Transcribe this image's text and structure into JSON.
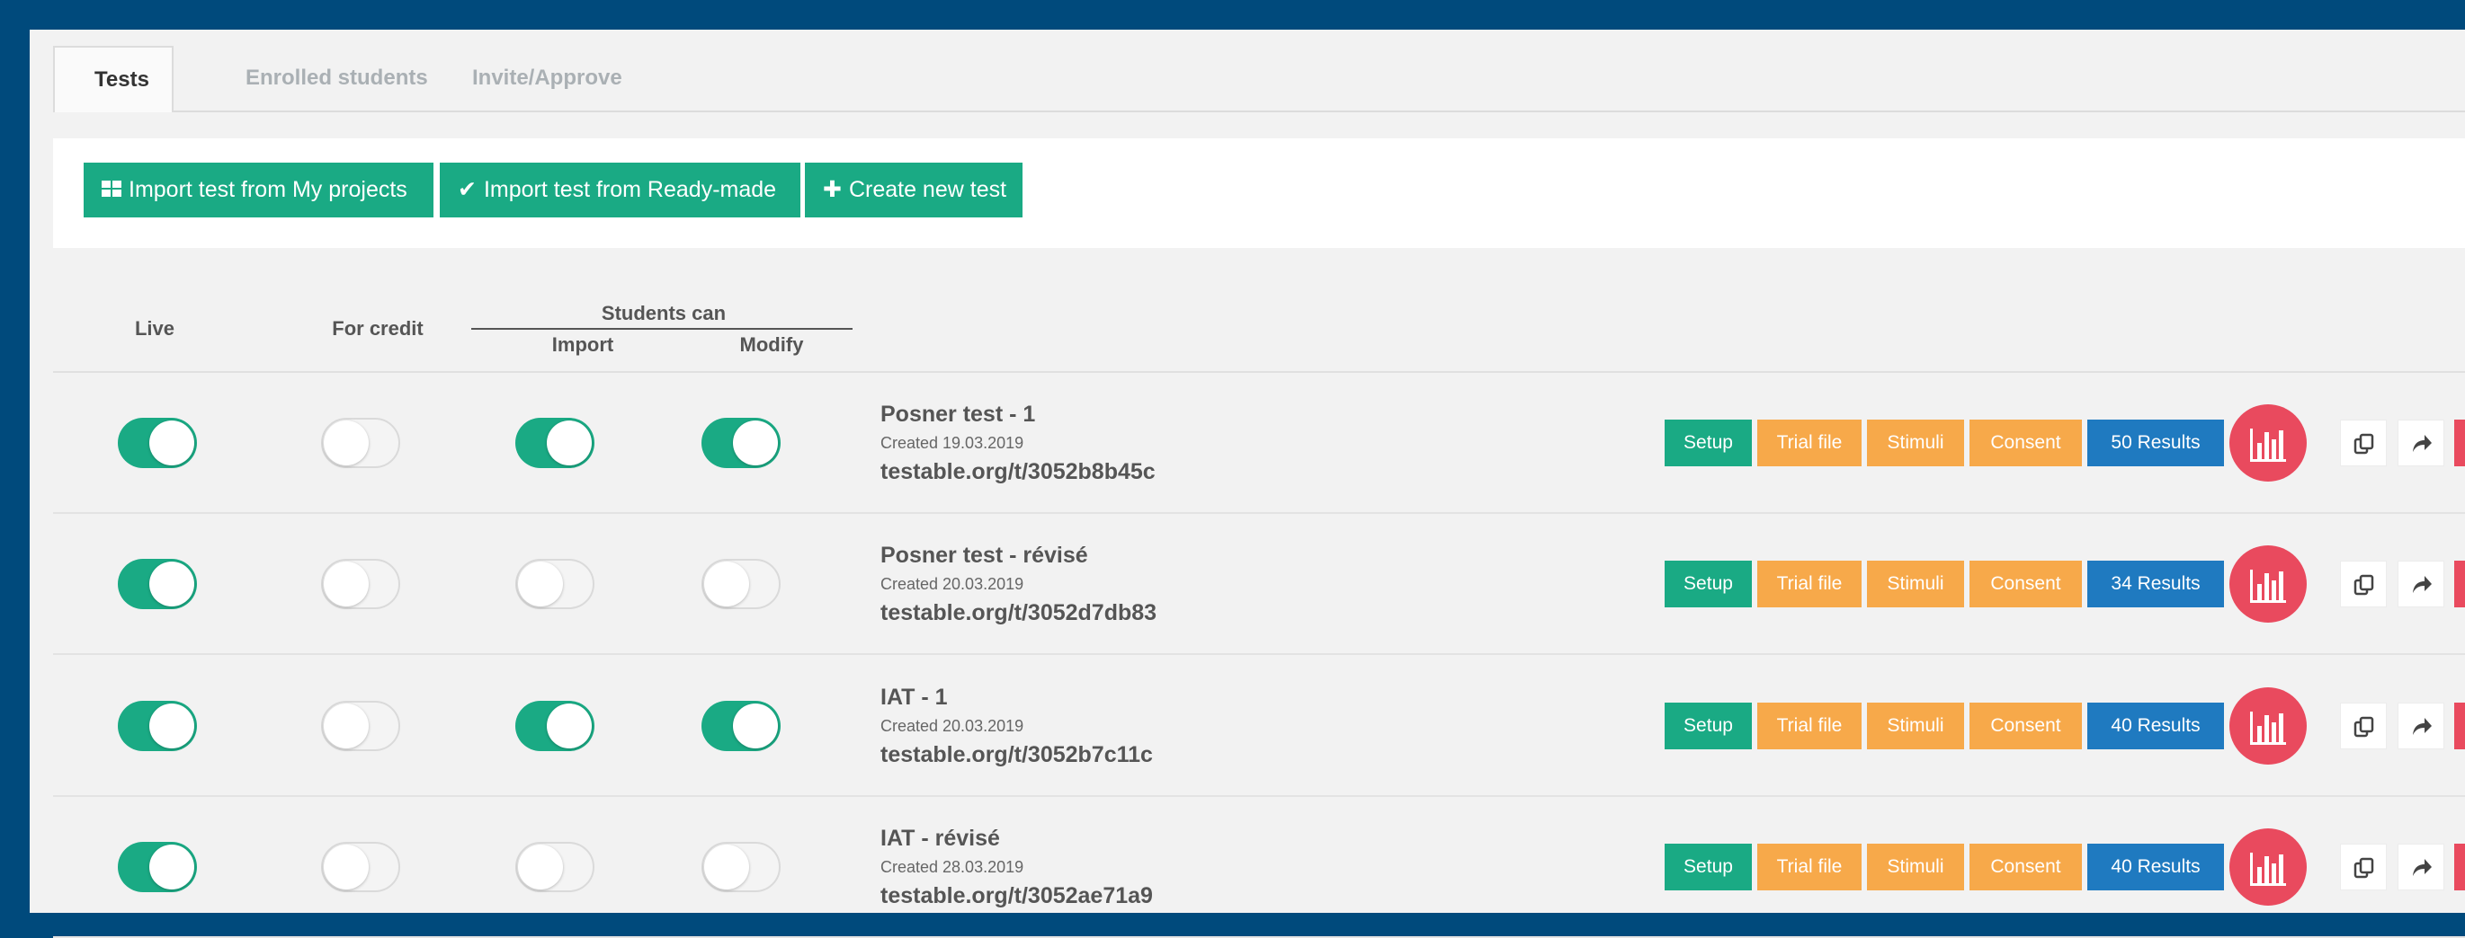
{
  "tabs": [
    {
      "label": "Tests",
      "active": true
    },
    {
      "label": "Enrolled students",
      "active": false
    },
    {
      "label": "Invite/Approve",
      "active": false
    }
  ],
  "toolbar": {
    "import_projects": "Import test from My projects",
    "import_readymade": "Import test from Ready-made",
    "create_new": "Create new test"
  },
  "columns": {
    "live": "Live",
    "for_credit": "For credit",
    "students_can": "Students can",
    "import": "Import",
    "modify": "Modify"
  },
  "row_buttons": {
    "setup": "Setup",
    "trial_file": "Trial file",
    "stimuli": "Stimuli",
    "consent": "Consent"
  },
  "colors": {
    "background": "#004a7c",
    "accent_green": "#1aaa84",
    "orange": "#f7a94a",
    "blue": "#1f7ac0",
    "red": "#e94a5e"
  },
  "icons": {
    "import_projects": "grid-icon",
    "import_readymade": "checkmark-icon",
    "create_new": "plus-icon",
    "chart": "bar-chart-icon",
    "copy": "copy-icon",
    "share": "share-arrow-icon",
    "delete": "trash-icon"
  },
  "tests": [
    {
      "name": "Posner test - 1",
      "created": "Created 19.03.2019",
      "url": "testable.org/t/3052b8b45c",
      "results": "50 Results",
      "live": true,
      "for_credit": false,
      "import": true,
      "modify": true
    },
    {
      "name": "Posner test - révisé",
      "created": "Created 20.03.2019",
      "url": "testable.org/t/3052d7db83",
      "results": "34 Results",
      "live": true,
      "for_credit": false,
      "import": false,
      "modify": false
    },
    {
      "name": "IAT - 1",
      "created": "Created 20.03.2019",
      "url": "testable.org/t/3052b7c11c",
      "results": "40 Results",
      "live": true,
      "for_credit": false,
      "import": true,
      "modify": true
    },
    {
      "name": "IAT - révisé",
      "created": "Created 28.03.2019",
      "url": "testable.org/t/3052ae71a9",
      "results": "40 Results",
      "live": true,
      "for_credit": false,
      "import": false,
      "modify": false
    }
  ]
}
